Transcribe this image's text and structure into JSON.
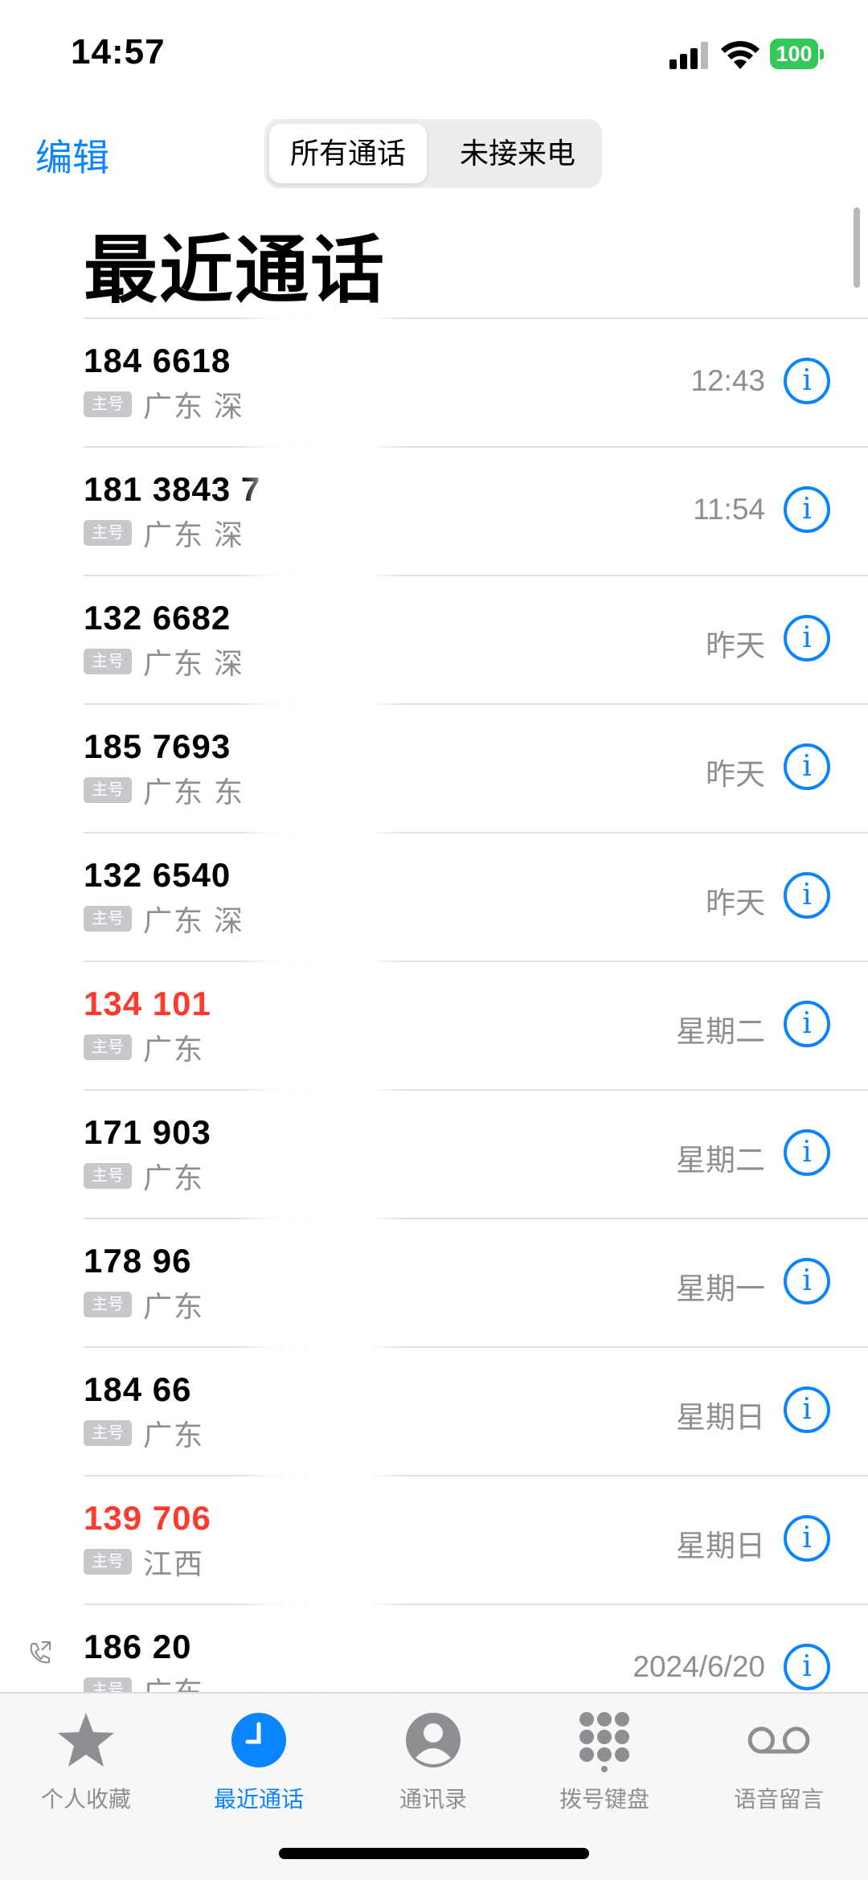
{
  "status_bar": {
    "time": "14:57",
    "battery": "100"
  },
  "nav": {
    "edit_label": "编辑",
    "segments": [
      "所有通话",
      "未接来电"
    ],
    "title": "最近通话"
  },
  "calls": [
    {
      "number": "184 6618",
      "tag": "主号",
      "location": "广东 深",
      "date": "12:43",
      "missed": false
    },
    {
      "number": "181 3843 7",
      "tag": "主号",
      "location": "广东 深",
      "date": "11:54",
      "missed": false
    },
    {
      "number": "132 6682",
      "tag": "主号",
      "location": "广东 深",
      "date": "昨天",
      "missed": false
    },
    {
      "number": "185 7693",
      "tag": "主号",
      "location": "广东 东",
      "date": "昨天",
      "missed": false
    },
    {
      "number": "132 6540",
      "tag": "主号",
      "location": "广东 深",
      "date": "昨天",
      "missed": false
    },
    {
      "number": "134 101",
      "tag": "主号",
      "location": "广东",
      "date": "星期二",
      "missed": true
    },
    {
      "number": "171 903",
      "tag": "主号",
      "location": "广东",
      "date": "星期二",
      "missed": false
    },
    {
      "number": "178 96",
      "tag": "主号",
      "location": "广东",
      "date": "星期一",
      "missed": false
    },
    {
      "number": "184 66",
      "tag": "主号",
      "location": "广东",
      "date": "星期日",
      "missed": false
    },
    {
      "number": "139 706",
      "tag": "主号",
      "location": "江西",
      "date": "星期日",
      "missed": true
    },
    {
      "number": "186 20",
      "tag": "主号",
      "location": "广东",
      "date": "2024/6/20",
      "missed": false,
      "outgoing": true
    }
  ],
  "tab_bar": {
    "items": [
      {
        "label": "个人收藏",
        "icon": "star-icon"
      },
      {
        "label": "最近通话",
        "icon": "clock-icon",
        "active": true
      },
      {
        "label": "通讯录",
        "icon": "person-icon"
      },
      {
        "label": "拨号键盘",
        "icon": "keypad-icon"
      },
      {
        "label": "语音留言",
        "icon": "voicemail-icon"
      }
    ]
  },
  "colors": {
    "accent": "#0a84ff",
    "missed": "#ff3b30",
    "secondary": "#8e8e93",
    "battery": "#34c759"
  }
}
